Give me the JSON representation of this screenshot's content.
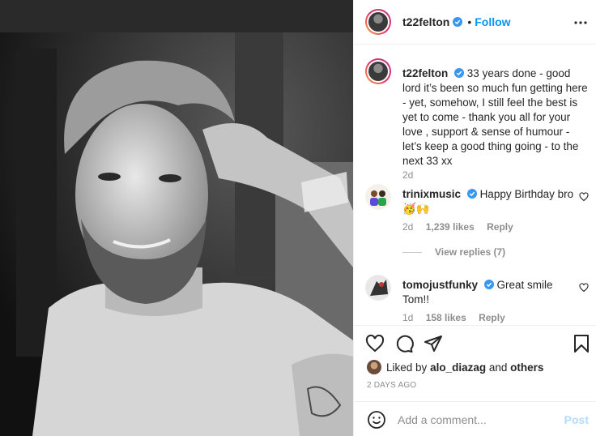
{
  "post": {
    "username": "t22felton",
    "follow_label": "Follow",
    "dot": "•",
    "caption": "33 years done - good lord it’s been so much fun getting here - yet, somehow, I still feel the best is yet to come - thank you all for your love , support & sense of humour - let’s keep a good thing going - to the next 33 xx",
    "caption_time": "2d"
  },
  "comments": [
    {
      "username": "trinixmusic",
      "text": "Happy Birthday bro 🥳🙌",
      "time": "2d",
      "likes": "1,239 likes",
      "reply_label": "Reply",
      "view_replies": "View replies (7)"
    },
    {
      "username": "tomojustfunky",
      "text": "Great smile Tom!!",
      "time": "1d",
      "likes": "158 likes",
      "reply_label": "Reply"
    }
  ],
  "likes": {
    "prefix": "Liked by",
    "user": "alo_diazag",
    "joiner": "and",
    "others": "others"
  },
  "timestamp": "2 DAYS AGO",
  "add_comment": {
    "placeholder": "Add a comment...",
    "post_label": "Post"
  },
  "colors": {
    "accent": "#0095f6",
    "post_disabled": "#b3dbff",
    "verified": "#3897f0"
  },
  "icons": [
    "more-icon",
    "verified-icon",
    "heart-icon",
    "comment-icon",
    "share-icon",
    "bookmark-icon",
    "emoji-icon"
  ]
}
